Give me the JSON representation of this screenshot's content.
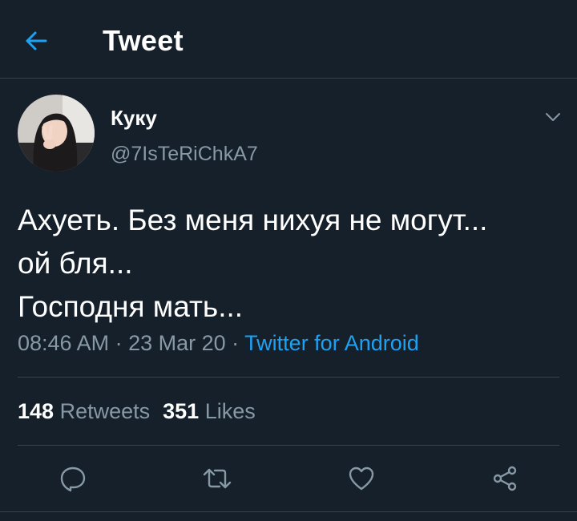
{
  "header": {
    "title": "Tweet",
    "back_icon": "arrow-left-icon"
  },
  "author": {
    "display_name": "Куку",
    "handle": "@7IsTeRiChkA7"
  },
  "tweet": {
    "lines": [
      "Ахуеть. Без меня нихуя не могут...",
      "ой бля...",
      "Господня мать..."
    ],
    "time": "08:46 AM",
    "date": "23 Mar 20",
    "separator": " · ",
    "source": "Twitter for Android"
  },
  "stats": {
    "retweets_count": "148",
    "retweets_label": "Retweets",
    "likes_count": "351",
    "likes_label": "Likes"
  },
  "actions": [
    "reply-icon",
    "retweet-icon",
    "like-icon",
    "share-icon"
  ],
  "colors": {
    "background": "#15202b",
    "accent": "#1da1f2",
    "secondary_text": "#8899a6",
    "divider": "#38444d"
  }
}
